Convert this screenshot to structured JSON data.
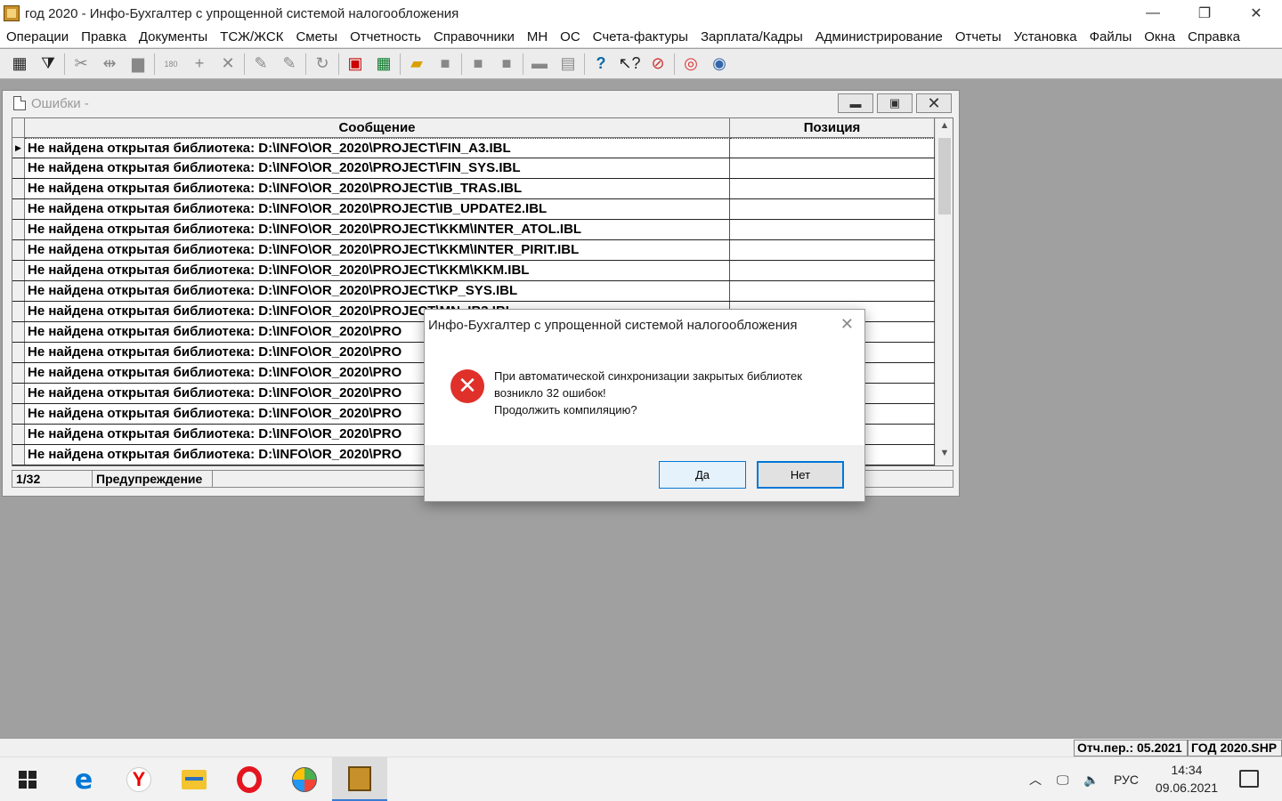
{
  "app": {
    "title": "год 2020 - Инфо-Бухгалтер с упрощенной системой налогообложения",
    "controls": {
      "minimize": "—",
      "maximize": "❐",
      "close": "✕"
    }
  },
  "menu": [
    "Операции",
    "Правка",
    "Документы",
    "ТСЖ/ЖСК",
    "Сметы",
    "Отчетность",
    "Справочники",
    "МН",
    "ОС",
    "Счета-фактуры",
    "Зарплата/Кадры",
    "Администрирование",
    "Отчеты",
    "Установка",
    "Файлы",
    "Окна",
    "Справка"
  ],
  "toolbar": {
    "icons": [
      "table-icon",
      "filter-icon",
      "cut-icon",
      "split-icon",
      "paste-icon",
      "numbering-icon",
      "add-icon",
      "delete-icon",
      "tool-icon",
      "tool2-icon",
      "refresh-icon",
      "calendar-icon",
      "calculator-icon",
      "open-folder-icon",
      "save-icon",
      "square-icon",
      "square2-icon",
      "print-icon",
      "preview-icon",
      "help-icon",
      "whats-this-icon",
      "compass-icon",
      "lifebuoy-icon",
      "network-icon"
    ],
    "glyphs": {
      "numbering": "180"
    }
  },
  "errors_window": {
    "title": "Ошибки -",
    "columns": [
      "Сообщение",
      "Позиция"
    ],
    "rows": [
      "Не найдена открытая библиотека: D:\\INFO\\OR_2020\\PROJECT\\FIN_A3.IBL",
      "Не найдена открытая библиотека: D:\\INFO\\OR_2020\\PROJECT\\FIN_SYS.IBL",
      "Не найдена открытая библиотека: D:\\INFO\\OR_2020\\PROJECT\\IB_TRAS.IBL",
      "Не найдена открытая библиотека: D:\\INFO\\OR_2020\\PROJECT\\IB_UPDATE2.IBL",
      "Не найдена открытая библиотека: D:\\INFO\\OR_2020\\PROJECT\\KKM\\INTER_ATOL.IBL",
      "Не найдена открытая библиотека: D:\\INFO\\OR_2020\\PROJECT\\KKM\\INTER_PIRIT.IBL",
      "Не найдена открытая библиотека: D:\\INFO\\OR_2020\\PROJECT\\KKM\\KKM.IBL",
      "Не найдена открытая библиотека: D:\\INFO\\OR_2020\\PROJECT\\KP_SYS.IBL",
      "Не найдена открытая библиотека: D:\\INFO\\OR_2020\\PROJECT\\MN_IB3.IBL",
      "Не найдена открытая библиотека: D:\\INFO\\OR_2020\\PRO",
      "Не найдена открытая библиотека: D:\\INFO\\OR_2020\\PRO",
      "Не найдена открытая библиотека: D:\\INFO\\OR_2020\\PRO",
      "Не найдена открытая библиотека: D:\\INFO\\OR_2020\\PRO",
      "Не найдена открытая библиотека: D:\\INFO\\OR_2020\\PRO",
      "Не найдена открытая библиотека: D:\\INFO\\OR_2020\\PRO",
      "Не найдена открытая библиотека: D:\\INFO\\OR_2020\\PRO"
    ],
    "status_position": "1/32",
    "status_type": "Предупреждение"
  },
  "dialog": {
    "title": "Инфо-Бухгалтер с упрощенной системой налогообложения",
    "line1": "При автоматической синхронизации закрытых библиотек",
    "line2": "возникло 32 ошибок!",
    "line3": "Продолжить компиляцию?",
    "yes": "Да",
    "no": "Нет"
  },
  "statusbar": {
    "period": "Отч.пер.: 05.2021",
    "file": "ГОД 2020.SHP"
  },
  "taskbar": {
    "apps": [
      "windows-start-icon",
      "edge-icon",
      "yandex-browser-icon",
      "file-explorer-icon",
      "opera-icon",
      "globe-app-icon",
      "info-buhgalter-icon"
    ],
    "tray_lang": "РУС",
    "time": "14:34",
    "date": "09.06.2021"
  }
}
